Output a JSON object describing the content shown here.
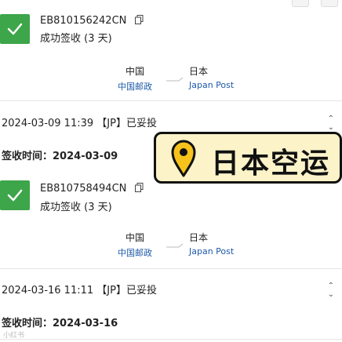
{
  "shipments": [
    {
      "tracking_number": "EB810156242CN",
      "status": "成功签收 (3 天)",
      "origin": {
        "country": "中国",
        "carrier": "中国邮政"
      },
      "destination": {
        "country": "日本",
        "carrier": "Japan Post"
      },
      "latest_event": "2024-03-09 11:39 【JP】已妥投",
      "signed_label": "签收时间：",
      "signed_date": "2024-03-09"
    },
    {
      "tracking_number": "EB810758494CN",
      "status": "成功签收 (3 天)",
      "origin": {
        "country": "中国",
        "carrier": "中国邮政"
      },
      "destination": {
        "country": "日本",
        "carrier": "Japan Post"
      },
      "latest_event": "2024-03-16 11:11 【JP】已妥投",
      "signed_label": "签收时间：",
      "signed_date": "2024-03-16"
    }
  ],
  "overlay": {
    "text": "日本空运",
    "icon": "map-pin-icon"
  },
  "watermark": "小红书",
  "colors": {
    "success": "#3da54a",
    "link": "#1d5aa8",
    "badge_bg": "#fcf3c9",
    "pin": "#f6c21c"
  }
}
